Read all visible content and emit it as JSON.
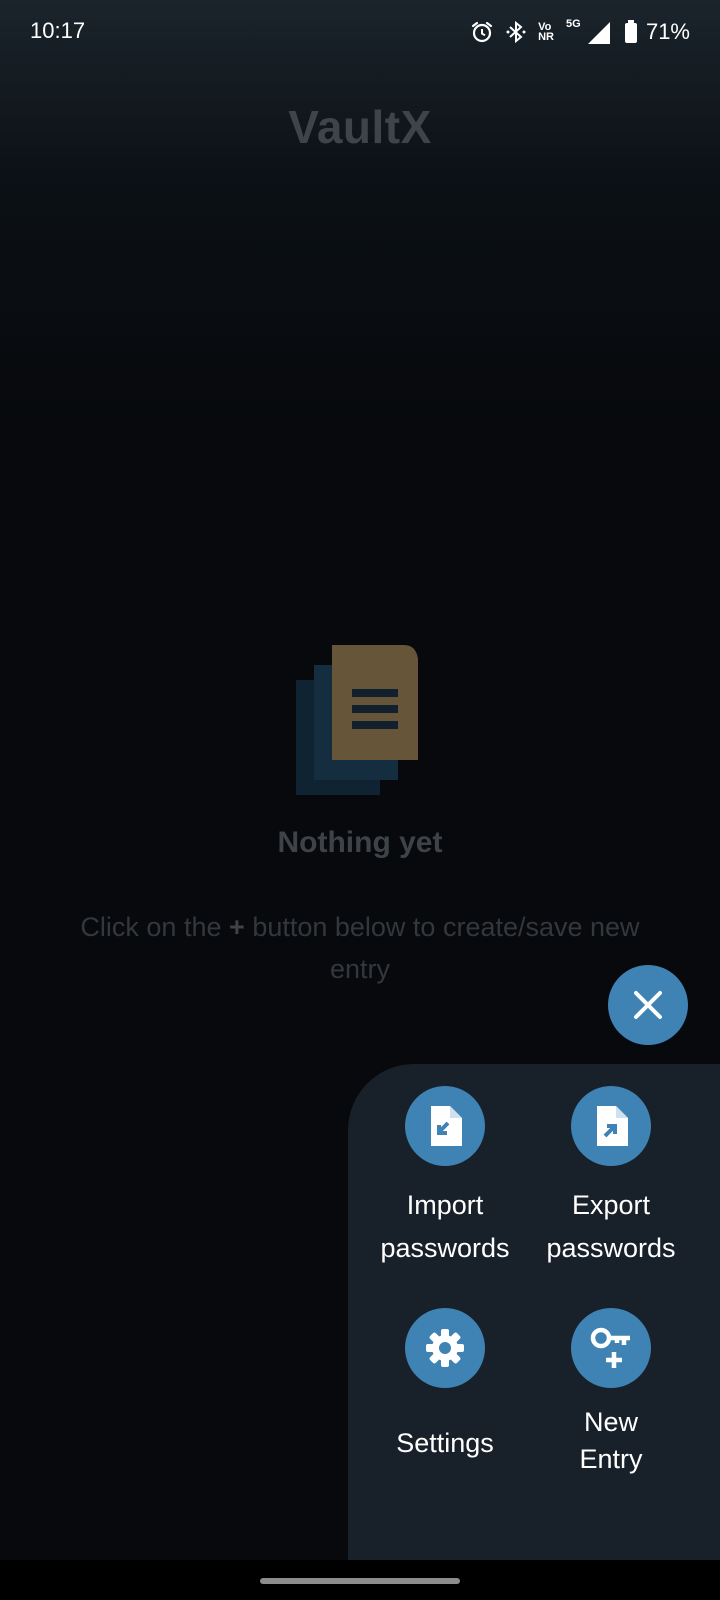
{
  "status_bar": {
    "time": "10:17",
    "network_top": "Vo",
    "network_bottom": "NR",
    "signal_label": "5G",
    "battery": "71%",
    "icons": [
      "alarm-icon",
      "bluetooth-icon",
      "volte-icon",
      "signal-icon",
      "battery-icon"
    ]
  },
  "app": {
    "title": "VaultX"
  },
  "empty_state": {
    "title": "Nothing yet",
    "hint_before": "Click on the",
    "hint_plus": "+",
    "hint_after": "button below to create/save new entry"
  },
  "fab": {
    "icon": "close-icon"
  },
  "actions": [
    {
      "label": "Import passwords",
      "icon": "file-import-icon"
    },
    {
      "label": "Export passwords",
      "icon": "file-export-icon"
    },
    {
      "label": "Settings",
      "icon": "gear-icon"
    },
    {
      "label": "New Entry",
      "icon": "key-plus-icon"
    }
  ],
  "colors": {
    "accent": "#3f82b4",
    "panel": "#182029",
    "background": "#07090c",
    "illustration_doc": "#b5935f",
    "illustration_stack": "#1f4d6b"
  }
}
